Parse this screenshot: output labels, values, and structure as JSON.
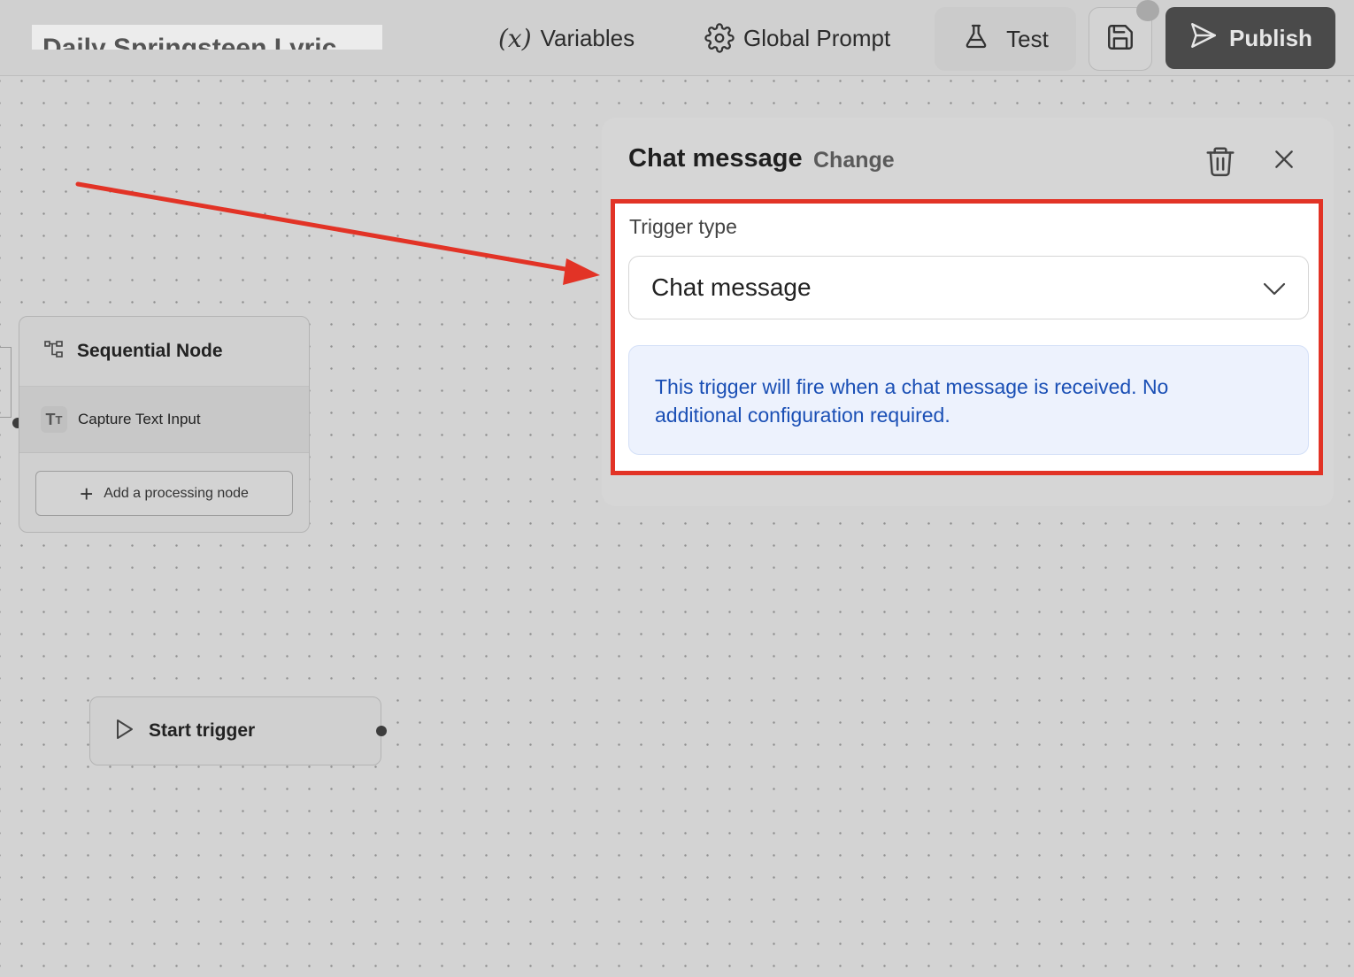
{
  "header": {
    "app_title": "Daily Springsteen Lyric",
    "variables_label": "Variables",
    "global_prompt_label": "Global Prompt",
    "test_label": "Test",
    "publish_label": "Publish"
  },
  "canvas": {
    "sequential_node": {
      "title": "Sequential Node",
      "step_label": "Capture Text Input",
      "add_label": "Add a processing node"
    },
    "start_trigger": {
      "label": "Start trigger"
    }
  },
  "panel": {
    "title": "Chat message",
    "change_label": "Change",
    "trigger_type_label": "Trigger type",
    "trigger_type_value": "Chat message",
    "info_text": "This trigger will fire when a chat message is received. No additional configuration required."
  },
  "colors": {
    "annotation_red": "#e23326",
    "info_text_blue": "#1a4fb5",
    "info_bg": "#edf2fd",
    "publish_bg": "#4a4a4a"
  },
  "icons": [
    "variables-icon",
    "gear-icon",
    "flask-icon",
    "save-icon",
    "send-icon",
    "sequence-icon",
    "text-icon",
    "plus-icon",
    "play-icon",
    "trash-icon",
    "close-icon",
    "chevron-down-icon"
  ]
}
